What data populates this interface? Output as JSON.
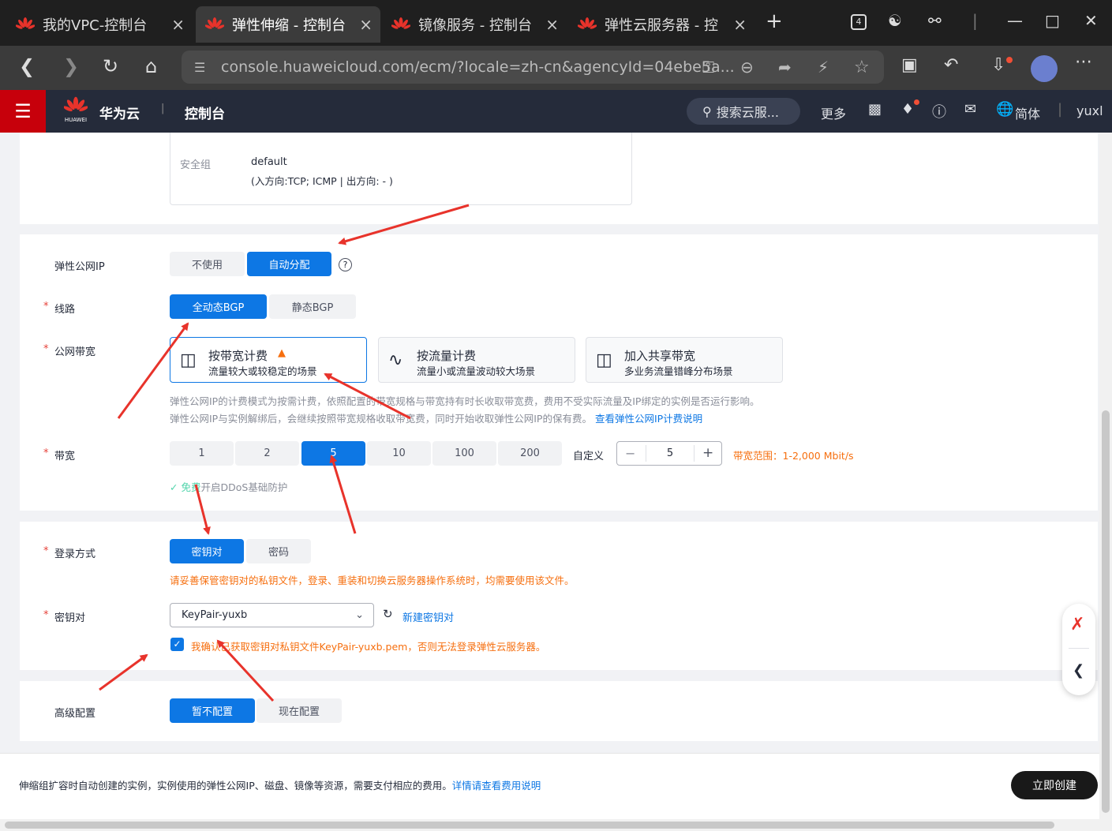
{
  "browser": {
    "tabs": [
      {
        "label": "我的VPC-控制台",
        "active": false
      },
      {
        "label": "弹性伸缩 - 控制台",
        "active": true
      },
      {
        "label": "镜像服务 - 控制台",
        "active": false
      },
      {
        "label": "弹性云服务器 - 控",
        "active": false
      }
    ],
    "tab_close": "×",
    "new_tab": "+",
    "tab_count": "4",
    "url": "console.huaweicloud.com/ecm/?locale=zh-cn&agencyId=04ebe5a..."
  },
  "header": {
    "brand": "华为云",
    "logo_text": "HUAWEI",
    "console": "控制台",
    "search_placeholder": "搜索云服...",
    "more": "更多",
    "lang": "简体",
    "user": "yuxl"
  },
  "security": {
    "label": "安全组",
    "value": "default",
    "rules": "(入方向:TCP; ICMP | 出方向: - )"
  },
  "eip": {
    "label": "弹性公网IP",
    "options": [
      "不使用",
      "自动分配"
    ],
    "selected": "自动分配"
  },
  "line": {
    "label": "线路",
    "options": [
      "全动态BGP",
      "静态BGP"
    ],
    "selected": "全动态BGP"
  },
  "bandwidth_type": {
    "label": "公网带宽",
    "cards": [
      {
        "title": "按带宽计费",
        "desc": "流量较大或较稳定的场景",
        "icon": "router-icon"
      },
      {
        "title": "按流量计费",
        "desc": "流量小或流量波动较大场景",
        "icon": "chart-line-icon"
      },
      {
        "title": "加入共享带宽",
        "desc": "多业务流量错峰分布场景",
        "icon": "shared-router-icon"
      }
    ],
    "note1": "弹性公网IP的计费模式为按需计费，依照配置的带宽规格与带宽持有时长收取带宽费，费用不受实际流量及IP绑定的实例是否运行影响。",
    "note2": "弹性公网IP与实例解绑后，会继续按照带宽规格收取带宽费，同时开始收取弹性公网IP的保有费。",
    "note_link": "查看弹性公网IP计费说明"
  },
  "bandwidth": {
    "label": "带宽",
    "options": [
      "1",
      "2",
      "5",
      "10",
      "100",
      "200"
    ],
    "selected": "5",
    "custom_label": "自定义",
    "custom_value": "5",
    "range": "带宽范围：1-2,000 Mbit/s",
    "ddos_free": "免费",
    "ddos_text": "开启DDoS基础防护"
  },
  "login": {
    "label": "登录方式",
    "options": [
      "密钥对",
      "密码"
    ],
    "selected": "密钥对",
    "warning": "请妥善保管密钥对的私钥文件，登录、重装和切换云服务器操作系统时，均需要使用该文件。"
  },
  "keypair": {
    "label": "密钥对",
    "value": "KeyPair-yuxb",
    "new_link": "新建密钥对",
    "confirm_text": "我确认已获取密钥对私钥文件KeyPair-yuxb.pem，否则无法登录弹性云服务器。",
    "confirmed": true
  },
  "advanced": {
    "label": "高级配置",
    "options": [
      "暂不配置",
      "现在配置"
    ],
    "selected": "暂不配置"
  },
  "footer": {
    "text": "伸缩组扩容时自动创建的实例，实例使用的弹性公网IP、磁盘、镜像等资源，需要支付相应的费用。",
    "link": "详情请查看费用说明",
    "create_button": "立即创建"
  },
  "colors": {
    "primary": "#0d77e4",
    "brand_red": "#c7000b",
    "orange": "#f66f0f",
    "annotation_red": "#e8332b",
    "green": "#50d4ab"
  }
}
